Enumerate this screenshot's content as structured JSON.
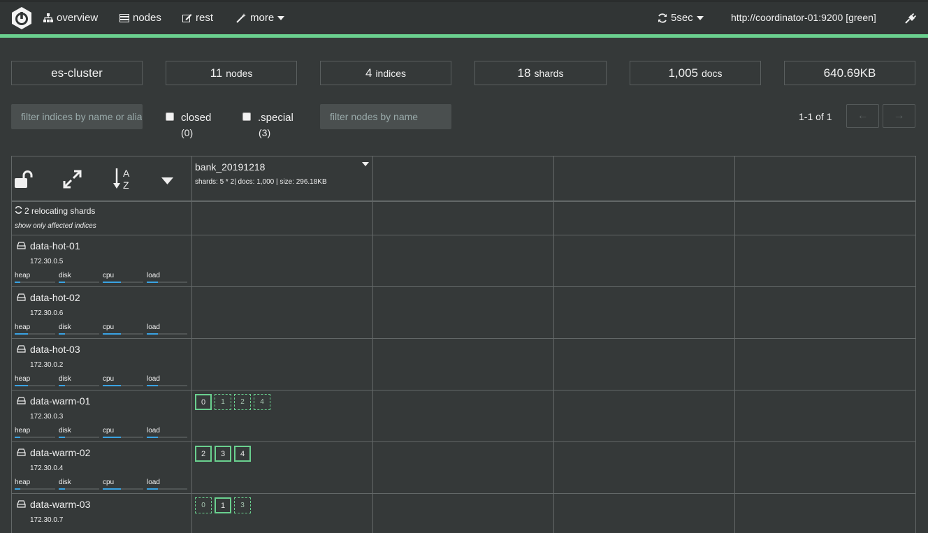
{
  "nav": {
    "items": [
      {
        "label": "overview",
        "icon": "sitemap-icon"
      },
      {
        "label": "nodes",
        "icon": "server-icon"
      },
      {
        "label": "rest",
        "icon": "edit-icon"
      },
      {
        "label": "more",
        "icon": "magic-wand-icon"
      }
    ],
    "refresh_label": "5sec",
    "connection": "http://coordinator-01:9200 [green]"
  },
  "colors": {
    "status": "#6ad08f",
    "metric_bar": "#3aa3e3"
  },
  "stats": {
    "cluster": "es-cluster",
    "nodes_num": "11",
    "nodes_lbl": "nodes",
    "indices_num": "4",
    "indices_lbl": "indices",
    "shards_num": "18",
    "shards_lbl": "shards",
    "docs_num": "1,005",
    "docs_lbl": "docs",
    "size": "640.69KB"
  },
  "filters": {
    "indices_placeholder": "filter indices by name or aliases",
    "closed_label": "closed",
    "closed_count": "(0)",
    "special_label": ".special",
    "special_count": "(3)",
    "nodes_placeholder": "filter nodes by name"
  },
  "pager": {
    "text": "1-1 of 1",
    "prev": "←",
    "next": "→"
  },
  "index": {
    "name": "bank_20191218",
    "meta": "shards: 5 * 2| docs: 1,000 | size: 296.18KB"
  },
  "relocating": {
    "text": "2 relocating shards",
    "affected": "show only affected indices"
  },
  "metric_labels": {
    "heap": "heap",
    "disk": "disk",
    "cpu": "cpu",
    "load": "load"
  },
  "nodes": [
    {
      "name": "data-hot-01",
      "ip": "172.30.0.5",
      "heap": 0.13,
      "disk": 0.15,
      "cpu": 0.45,
      "load": 0.28
    },
    {
      "name": "data-hot-02",
      "ip": "172.30.0.6",
      "heap": 0.33,
      "disk": 0.15,
      "cpu": 0.45,
      "load": 0.28
    },
    {
      "name": "data-hot-03",
      "ip": "172.30.0.2",
      "heap": 0.33,
      "disk": 0.15,
      "cpu": 0.45,
      "load": 0.28
    },
    {
      "name": "data-warm-01",
      "ip": "172.30.0.3",
      "heap": 0.13,
      "disk": 0.15,
      "cpu": 0.45,
      "load": 0.28
    },
    {
      "name": "data-warm-02",
      "ip": "172.30.0.4",
      "heap": 0.13,
      "disk": 0.15,
      "cpu": 0.45,
      "load": 0.28
    },
    {
      "name": "data-warm-03",
      "ip": "172.30.0.7",
      "heap": 0.13,
      "disk": 0.15,
      "cpu": 0.45,
      "load": 0.28
    }
  ],
  "shards": {
    "data-warm-01": [
      {
        "n": "0",
        "primary": true
      },
      {
        "n": "1",
        "primary": false
      },
      {
        "n": "2",
        "primary": false
      },
      {
        "n": "4",
        "primary": false
      }
    ],
    "data-warm-02": [
      {
        "n": "2",
        "primary": true
      },
      {
        "n": "3",
        "primary": true
      },
      {
        "n": "4",
        "primary": true
      }
    ],
    "data-warm-03": [
      {
        "n": "0",
        "primary": false
      },
      {
        "n": "1",
        "primary": true
      },
      {
        "n": "3",
        "primary": false
      }
    ]
  }
}
